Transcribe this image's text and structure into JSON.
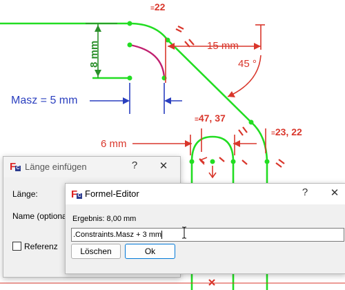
{
  "sketch": {
    "dims": {
      "d22": "22",
      "d15": "15 mm",
      "d8": "8 mm",
      "d45": "45 °",
      "masz": "Masz = 5 mm",
      "d47_37": "47, 37",
      "d23_22": "23, 22",
      "d6": "6 mm"
    },
    "colors": {
      "geometry": "#22dd22",
      "constraint": "#d9362b",
      "arc": "#c0206f",
      "expression": "#2a3fbf",
      "green_dim": "#2a8f2a"
    }
  },
  "insert_length_dialog": {
    "title": "Länge einfügen",
    "help_button": "?",
    "close_button": "✕",
    "length_label": "Länge:",
    "name_label": "Name (optional)",
    "reference_label": "Referenz",
    "reference_checked": false
  },
  "formula_editor": {
    "title": "Formel-Editor",
    "help_button": "?",
    "close_button": "✕",
    "result_text": "Ergebnis: 8,00 mm",
    "expression_value": ".Constraints.Masz + 3 mm",
    "clear_button": "Löschen",
    "ok_button": "Ok"
  }
}
